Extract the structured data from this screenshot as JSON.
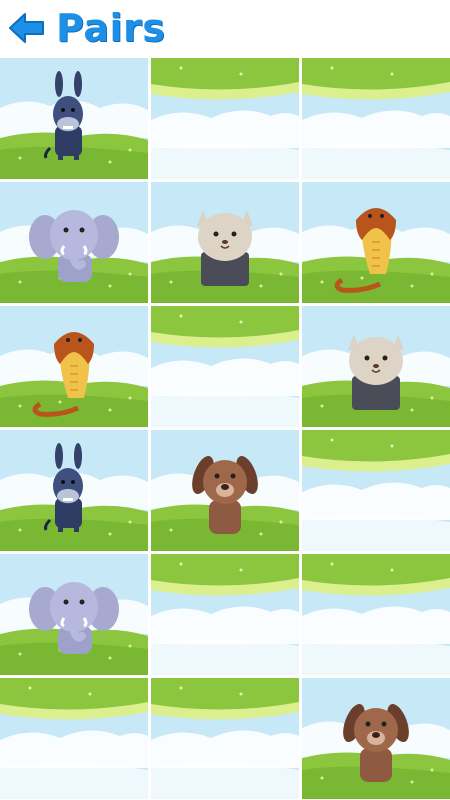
{
  "header": {
    "title": "Pairs",
    "back_icon": "arrow-left-icon"
  },
  "colors": {
    "accent": "#1e8fe6",
    "sky": "#bfe4f6",
    "grass": "#8cc63f"
  },
  "board": {
    "columns": 3,
    "rows": 6,
    "cards": [
      {
        "state": "face-up",
        "animal": "donkey"
      },
      {
        "state": "face-down",
        "animal": ""
      },
      {
        "state": "face-down",
        "animal": ""
      },
      {
        "state": "face-up",
        "animal": "elephant"
      },
      {
        "state": "face-up",
        "animal": "cat"
      },
      {
        "state": "face-up",
        "animal": "cobra"
      },
      {
        "state": "face-up",
        "animal": "cobra"
      },
      {
        "state": "face-down",
        "animal": ""
      },
      {
        "state": "face-up",
        "animal": "cat"
      },
      {
        "state": "face-up",
        "animal": "donkey"
      },
      {
        "state": "face-up",
        "animal": "dog"
      },
      {
        "state": "face-down",
        "animal": ""
      },
      {
        "state": "face-up",
        "animal": "elephant"
      },
      {
        "state": "face-down",
        "animal": ""
      },
      {
        "state": "face-down",
        "animal": ""
      },
      {
        "state": "face-down",
        "animal": ""
      },
      {
        "state": "face-down",
        "animal": ""
      },
      {
        "state": "face-up",
        "animal": "dog"
      }
    ]
  }
}
